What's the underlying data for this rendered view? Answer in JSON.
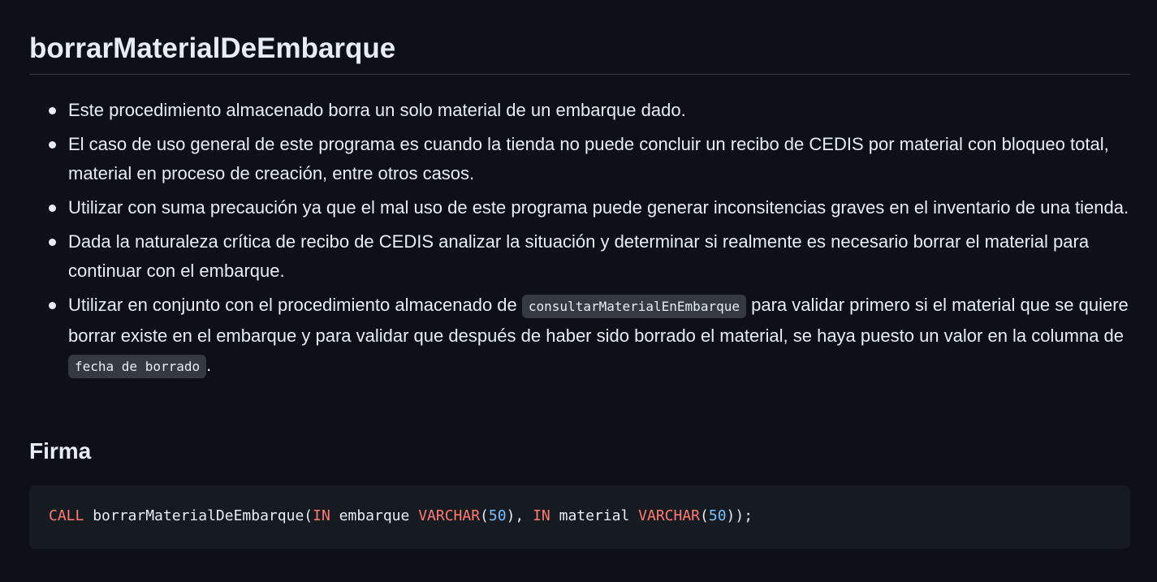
{
  "section": {
    "title": "borrarMaterialDeEmbarque"
  },
  "bullets": [
    {
      "text": "Este procedimiento almacenado borra un solo material de un embarque dado."
    },
    {
      "text": "El caso de uso general de este programa es cuando la tienda no puede concluir un recibo de CEDIS por material con bloqueo total, material en proceso de creación, entre otros casos."
    },
    {
      "text": "Utilizar con suma precaución ya que el mal uso de este programa puede generar inconsitencias graves en el inventario de una tienda."
    },
    {
      "text": "Dada la naturaleza crítica de recibo de CEDIS analizar la situación y determinar si realmente es necesario borrar el material para continuar con el embarque."
    },
    {
      "before": "Utilizar en conjunto con el procedimiento almacenado de ",
      "code1": "consultarMaterialEnEmbarque",
      "middle": " para validar primero si el material que se quiere borrar existe en el embarque y para validar que después de haber sido borrado el material, se haya puesto un valor en la columna de ",
      "code2": "fecha de borrado",
      "after": "."
    }
  ],
  "signature": {
    "title": "Firma",
    "code": {
      "kw_call": "CALL",
      "proc": " borrarMaterialDeEmbarque(",
      "kw_in1": "IN",
      "param1": " embarque ",
      "type1": "VARCHAR",
      "paren1": "(",
      "num1": "50",
      "sep": "), ",
      "kw_in2": "IN",
      "param2": " material ",
      "type2": "VARCHAR",
      "paren2": "(",
      "num2": "50",
      "end": "));"
    }
  },
  "colors": {
    "background": "#0d1117",
    "text": "#e6edf3",
    "rule": "#30363d",
    "inline_code_bg": "#343942",
    "code_block_bg": "#161b22",
    "keyword": "#ff7b72",
    "number": "#79c0ff"
  }
}
